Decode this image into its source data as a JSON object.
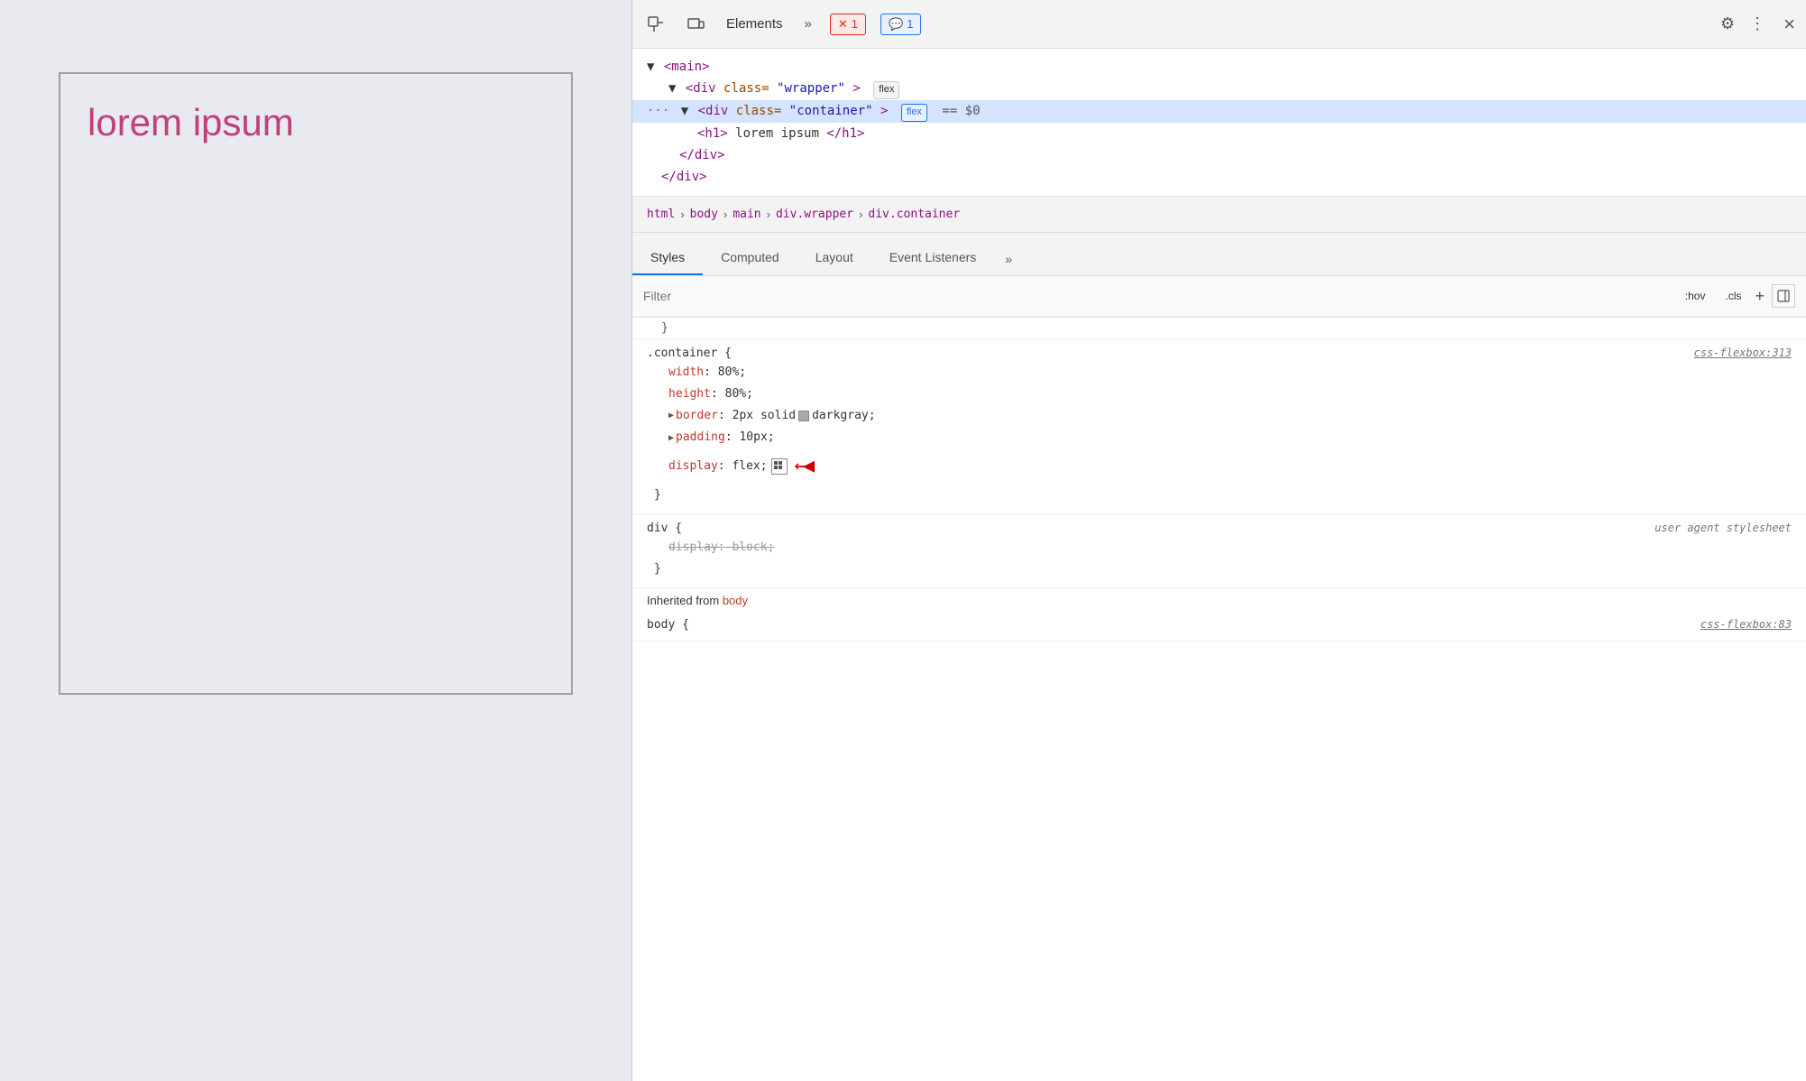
{
  "webpage": {
    "lorem_text": "lorem ipsum"
  },
  "devtools": {
    "toolbar": {
      "elements_label": "Elements",
      "more_tabs_label": "»",
      "error_badge_count": "1",
      "console_badge_count": "1",
      "close_label": "×"
    },
    "dom_tree": {
      "main_open": "<main>",
      "wrapper_open": "<div class=\"wrapper\">",
      "wrapper_flex_badge": "flex",
      "container_open": "<div class=\"container\">",
      "container_flex_badge": "flex",
      "container_equals": "==",
      "container_dollar": "$0",
      "h1_open": "<h1>",
      "h1_text": "lorem ipsum",
      "h1_close": "</h1>",
      "div_close": "</div>",
      "div_close2": "</div>"
    },
    "breadcrumb": {
      "items": [
        "html",
        "body",
        "main",
        "div.wrapper",
        "div.container"
      ]
    },
    "tabs": {
      "items": [
        "Styles",
        "Computed",
        "Layout",
        "Event Listeners",
        "»"
      ]
    },
    "filter": {
      "placeholder": "Filter",
      "hov_label": ":hov",
      "cls_label": ".cls",
      "plus_label": "+"
    },
    "styles": {
      "rule1": {
        "selector": ".container {",
        "source": "css-flexbox:313",
        "close": "}",
        "props": [
          {
            "name": "width",
            "colon": ":",
            "value": " 80%;"
          },
          {
            "name": "height",
            "colon": ":",
            "value": " 80%;"
          },
          {
            "name": "border",
            "colon": ":",
            "value": " 2px solid",
            "has_swatch": true,
            "swatch_color": "#a9a9a9",
            "swatch_label": "darkgray",
            "value_after": ";"
          },
          {
            "name": "padding",
            "colon": ":",
            "value": " 10px;",
            "has_expand": true
          },
          {
            "name": "display",
            "colon": ":",
            "value": " flex;",
            "has_grid_icon": true,
            "has_arrow": true
          }
        ]
      },
      "rule2": {
        "selector": "div {",
        "source": "user agent stylesheet",
        "close": "}",
        "props": [
          {
            "name": "display: block;",
            "strikethrough": true
          }
        ]
      },
      "inherited_label": "Inherited from",
      "inherited_element": "body",
      "rule3": {
        "partial": "body {"
      }
    }
  }
}
